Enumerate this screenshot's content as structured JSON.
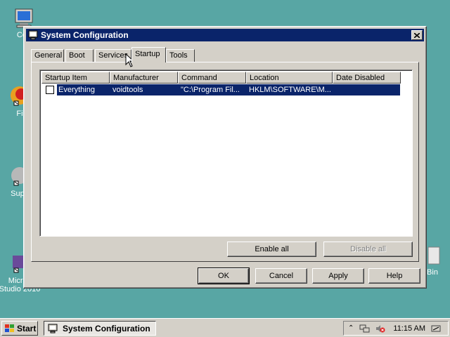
{
  "desktop": {
    "icons": [
      {
        "label": "Con"
      },
      {
        "label": "Fi"
      },
      {
        "label": "Supe"
      },
      {
        "label": "Micros",
        "label2": "Studio 2010"
      },
      {
        "label": "Bin"
      }
    ]
  },
  "window": {
    "title": "System Configuration",
    "tabs": [
      "General",
      "Boot",
      "Services",
      "Startup",
      "Tools"
    ],
    "active_tab": "Startup",
    "columns": [
      "Startup Item",
      "Manufacturer",
      "Command",
      "Location",
      "Date Disabled"
    ],
    "rows": [
      {
        "item": "Everything",
        "manufacturer": "voidtools",
        "command": "\"C:\\Program Fil...",
        "location": "HKLM\\SOFTWARE\\M...",
        "date_disabled": "",
        "checked": false
      }
    ],
    "enable_all": "Enable all",
    "disable_all": "Disable all",
    "ok": "OK",
    "cancel": "Cancel",
    "apply": "Apply",
    "help": "Help"
  },
  "taskbar": {
    "start": "Start",
    "task": "System Configuration",
    "clock": "11:15 AM"
  },
  "colors": {
    "desktop": "#58a6a4",
    "titlebar": "#0a246a",
    "selection": "#0a246a"
  }
}
